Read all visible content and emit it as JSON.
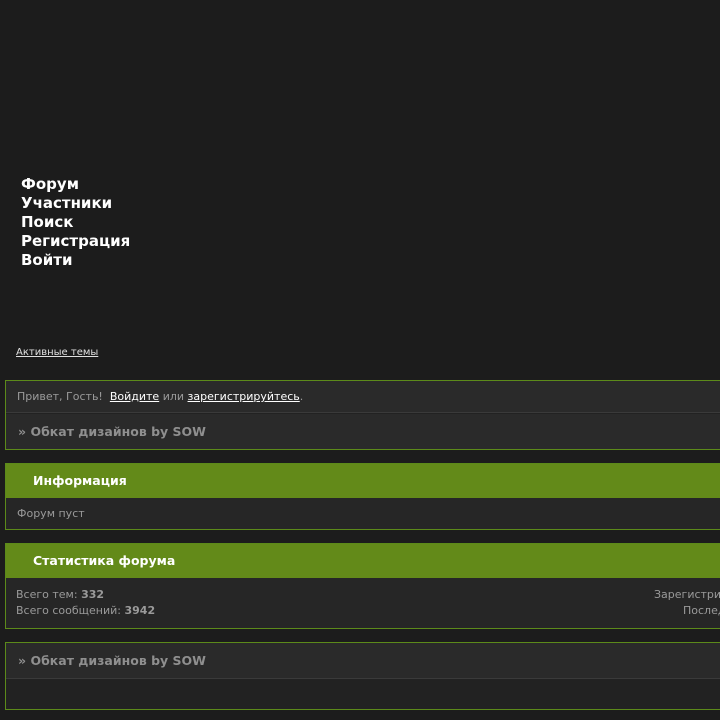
{
  "nav": {
    "items": [
      "Форум",
      "Участники",
      "Поиск",
      "Регистрация",
      "Войти"
    ]
  },
  "active_topics": "Активные темы",
  "welcome": {
    "greeting": "Привет, Гость!",
    "login": "Войдите",
    "or": "или",
    "register": "зарегистрируйтесь",
    "period": "."
  },
  "breadcrumb": {
    "arrow": "»",
    "title": "Обкат дизайнов by SOW"
  },
  "info": {
    "heading": "Информация",
    "text": "Форум пуст"
  },
  "stats": {
    "heading": "Статистика форума",
    "topics_label": "Всего тем:",
    "topics_value": "332",
    "posts_label": "Всего сообщений:",
    "posts_value": "3942",
    "registered_label": "Зарегистри",
    "last_label": "Послед"
  },
  "colors": {
    "accent": "#638a19",
    "background": "#1c1c1c"
  }
}
